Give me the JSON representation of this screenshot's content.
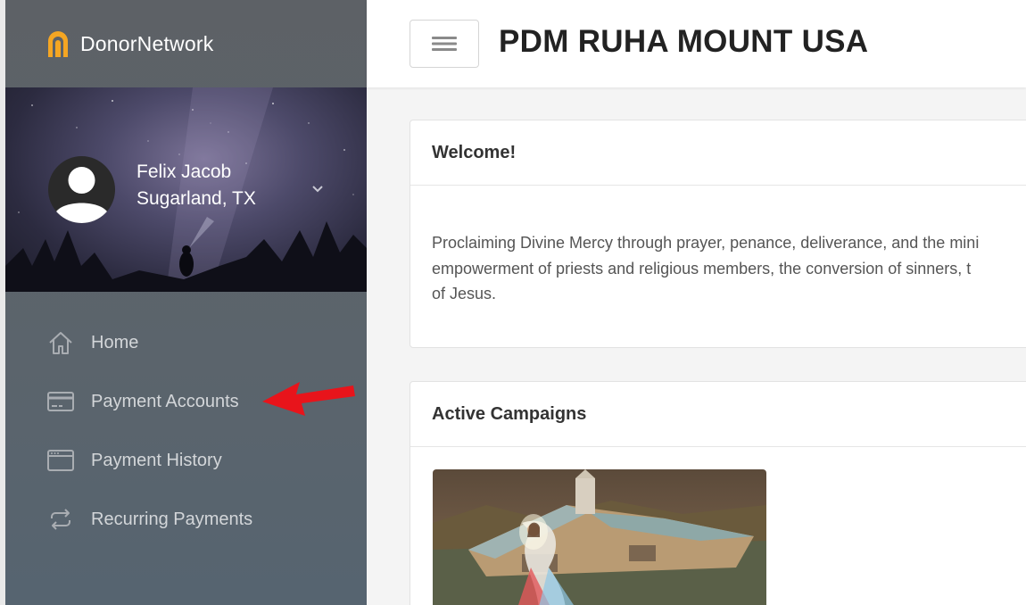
{
  "brand": {
    "name": "DonorNetwork",
    "logo_color": "#f5a623"
  },
  "user": {
    "name": "Felix Jacob",
    "location": "Sugarland, TX"
  },
  "nav": {
    "items": [
      {
        "label": "Home",
        "icon": "home-icon"
      },
      {
        "label": "Payment Accounts",
        "icon": "credit-card-icon"
      },
      {
        "label": "Payment History",
        "icon": "browser-window-icon"
      },
      {
        "label": "Recurring Payments",
        "icon": "repeat-icon"
      }
    ]
  },
  "annotation": {
    "type": "arrow",
    "color": "#e8141b",
    "points_to": "Payment Accounts"
  },
  "header": {
    "title": "PDM RUHA MOUNT USA",
    "menu_icon": "hamburger-icon"
  },
  "welcome": {
    "title": "Welcome!",
    "lines": [
      "Proclaiming Divine Mercy through prayer, penance, deliverance, and the mini",
      "empowerment of priests and religious members, the conversion of sinners, t",
      "of Jesus."
    ]
  },
  "campaigns": {
    "title": "Active Campaigns"
  }
}
